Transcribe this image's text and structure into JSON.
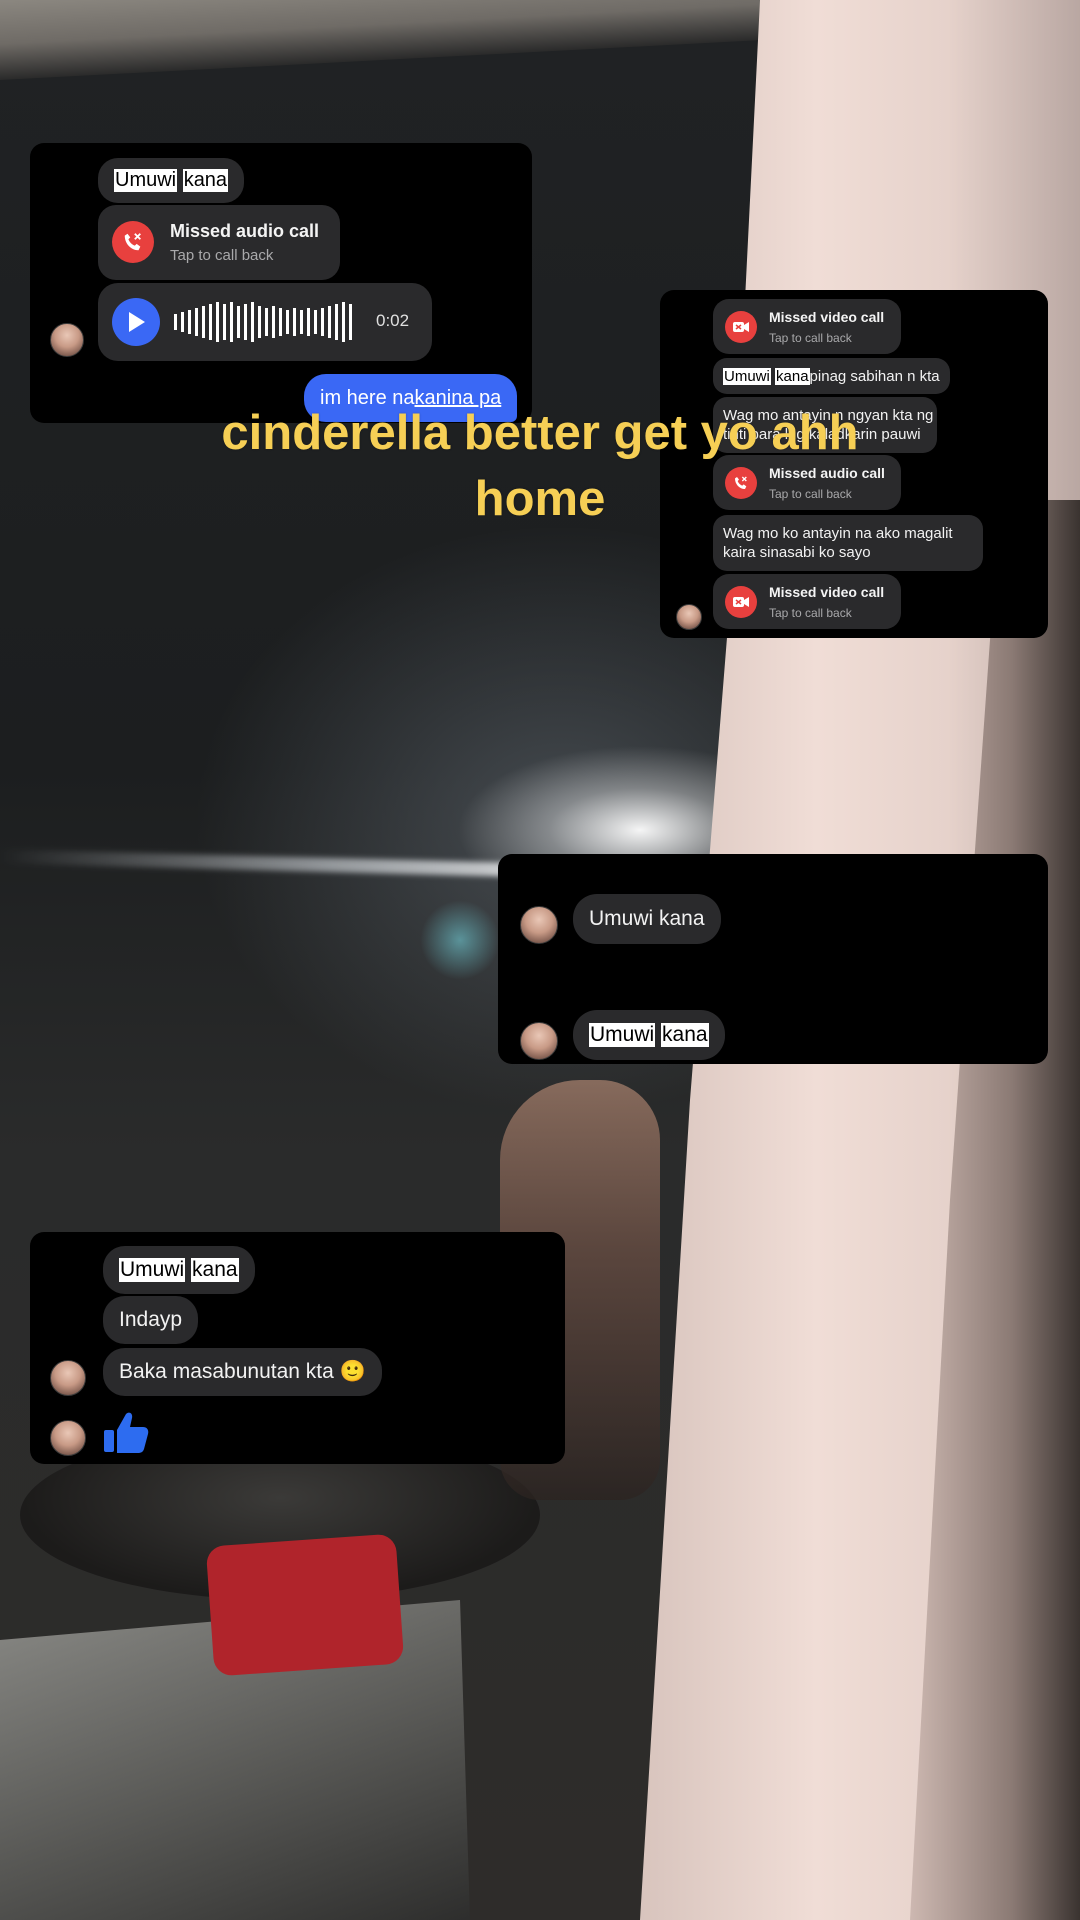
{
  "caption": {
    "text": "cinderella better get yo ahh home"
  },
  "card1": {
    "msg1": {
      "part1": "Umuwi",
      "part2": "kana"
    },
    "missed_call": {
      "title": "Missed audio call",
      "subtitle": "Tap to call back"
    },
    "voice_note": {
      "duration": "0:02"
    },
    "sent": {
      "part1": "im here na ",
      "part2": "kanina pa"
    }
  },
  "card2": {
    "call1": {
      "title": "Missed video call",
      "subtitle": "Tap to call back"
    },
    "msg1": {
      "part1": "Umuwi",
      "part2": "kana",
      "rest": " pinag sabihan n kta"
    },
    "msg2": {
      "line1": "Wag mo antayin n ngyan kta ng",
      "line2": "tinti para lng kaladkarin pauwi"
    },
    "call2": {
      "title": "Missed audio call",
      "subtitle": "Tap to call back"
    },
    "msg3": {
      "line1": "Wag mo ko antayin na ako magalit",
      "line2": "kaira sinasabi ko sayo"
    },
    "call3": {
      "title": "Missed video call",
      "subtitle": "Tap to call back"
    }
  },
  "card3": {
    "msg1": {
      "text": "Umuwi kana"
    },
    "msg2": {
      "part1": "Umuwi",
      "part2": "kana"
    }
  },
  "card4": {
    "msg1": {
      "part1": "Umuwi",
      "part2": "kana"
    },
    "msg2": {
      "text": "Indayp"
    },
    "msg3": {
      "text": "Baka masabunutan kta",
      "emoji": "🙂"
    }
  },
  "colors": {
    "sent_bubble": "#3a68f5",
    "missed_call_red": "#e8403e",
    "caption_yellow": "#f6cf55",
    "like_blue": "#2d6cf0"
  },
  "icons": {
    "missed_audio": "phone-missed-icon",
    "missed_video": "video-missed-icon",
    "play": "play-icon",
    "like": "thumbs-up-icon"
  }
}
